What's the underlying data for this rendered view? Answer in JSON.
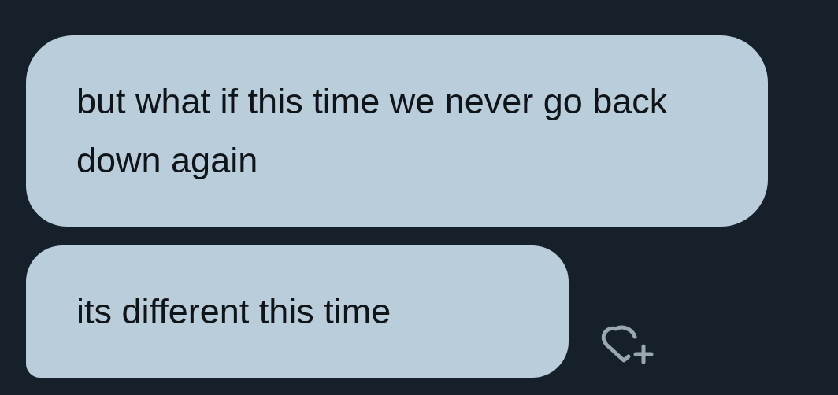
{
  "messages": [
    {
      "text": "but what if this time we never go back down again"
    },
    {
      "text": "its different this time"
    }
  ]
}
